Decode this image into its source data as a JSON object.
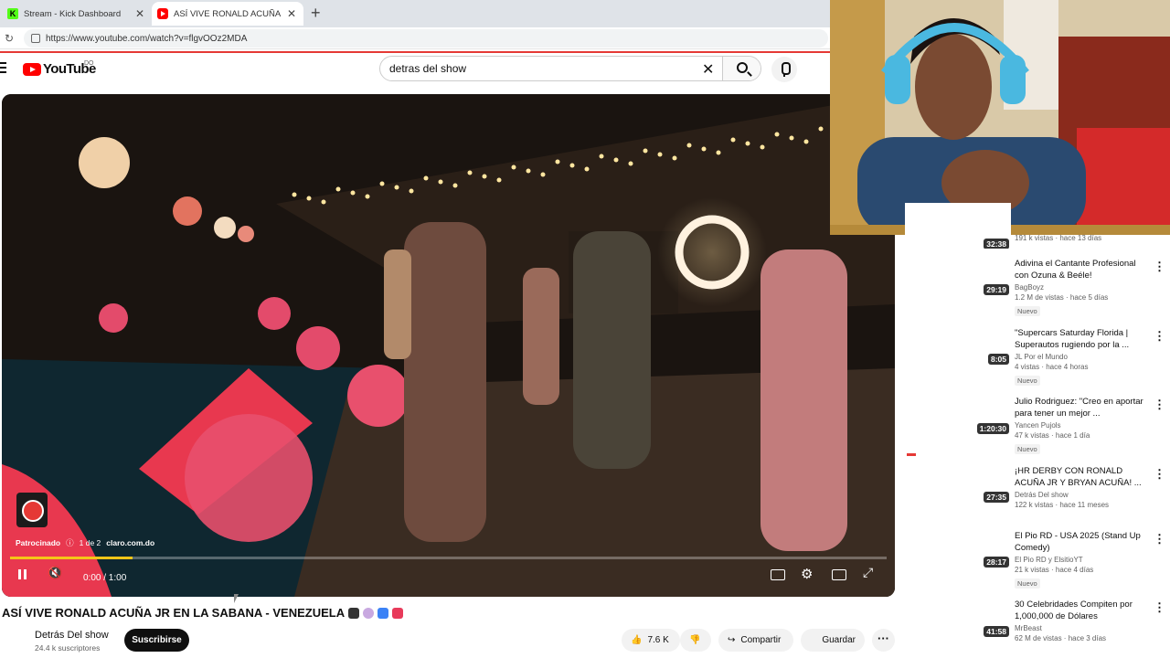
{
  "browser": {
    "tabs": [
      {
        "label": "Stream - Kick Dashboard",
        "icon": "kick-icon"
      },
      {
        "label": "ASÍ VIVE RONALD ACUÑA JR EN LA",
        "icon": "youtube-icon"
      }
    ],
    "url": "https://www.youtube.com/watch?v=flgvOOz2MDA"
  },
  "header": {
    "logo_text": "YouTube",
    "country": "DO",
    "search_value": "detras del show"
  },
  "player": {
    "ad_label": "Patrocinado",
    "ad_count": "1 de 2",
    "ad_domain": "claro.com.do",
    "time": "0:00 / 1:00",
    "progress_fraction": 0.14
  },
  "video": {
    "title": "ASÍ VIVE RONALD ACUÑA JR EN LA SABANA - VENEZUELA",
    "channel": "Detrás Del show",
    "subscribers": "24.4 k suscriptores",
    "subscribe_label": "Suscribirse",
    "likes": "7.6 K",
    "share_label": "Compartir",
    "save_label": "Guardar"
  },
  "recommendations": [
    {
      "title": "",
      "channel": "",
      "views": "191 k vistas · hace 13 días",
      "duration": "32:38",
      "badge": ""
    },
    {
      "title": "Adivina el Cantante Profesional con Ozuna & Beéle!",
      "channel": "BagBoyz",
      "views": "1.2 M de vistas · hace 5 días",
      "duration": "29:19",
      "badge": "Nuevo"
    },
    {
      "title": "\"Supercars Saturday Florida | Superautos rugiendo por la ...",
      "channel": "JL Por el Mundo",
      "views": "4 vistas · hace 4 horas",
      "duration": "8:05",
      "badge": "Nuevo"
    },
    {
      "title": "Julio Rodriguez: \"Creo en aportar para tener un mejor ...",
      "channel": "Yancen Pujols",
      "views": "47 k vistas · hace 1 día",
      "duration": "1:20:30",
      "badge": "Nuevo"
    },
    {
      "title": "¡HR DERBY CON RONALD ACUÑA JR Y BRYAN ACUÑA! ...",
      "channel": "Detrás Del show",
      "views": "122 k vistas · hace 11 meses",
      "duration": "27:35",
      "badge": ""
    },
    {
      "title": "El Pio RD - USA 2025 (Stand Up Comedy)",
      "channel": "El Pio RD  y ElsitioYT",
      "views": "21 k vistas · hace 4 días",
      "duration": "28:17",
      "badge": "Nuevo"
    },
    {
      "title": "30 Celebridades Compiten por 1,000,000 de Dólares",
      "channel": "MrBeast",
      "views": "62 M de vistas · hace 3 días",
      "duration": "41:58",
      "badge": ""
    }
  ]
}
